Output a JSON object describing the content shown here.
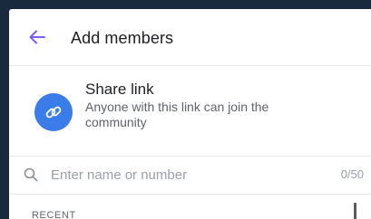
{
  "header": {
    "title": "Add members"
  },
  "share": {
    "title": "Share link",
    "subtitle": "Anyone with this link can join the community"
  },
  "search": {
    "placeholder": "Enter name or number",
    "value": "",
    "counter": "0/50"
  },
  "sections": {
    "recent": "RECENT"
  },
  "colors": {
    "accent": "#7b5cff",
    "share_icon_bg": "#3a7ce8",
    "frame_bg": "#1a2a3e"
  }
}
